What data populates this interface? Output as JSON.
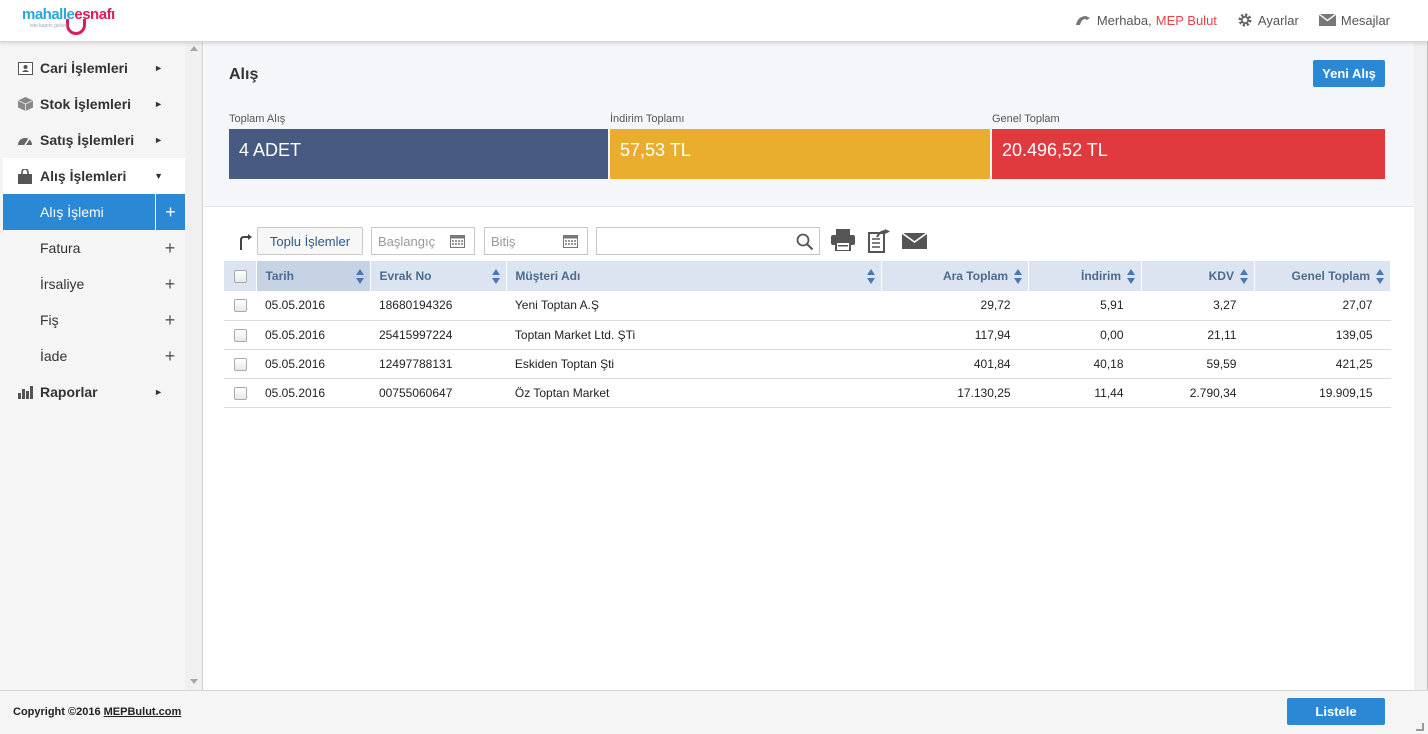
{
  "header": {
    "logo": {
      "word1": "mahalle",
      "word2": "esnafı",
      "tagline": "iste kapını gelsin"
    },
    "greeting": "Merhaba,",
    "user_name": "MEP Bulut",
    "settings_label": "Ayarlar",
    "messages_label": "Mesajlar"
  },
  "sidebar": {
    "items": [
      {
        "label": "Cari İşlemleri",
        "icon": "contact-card-icon"
      },
      {
        "label": "Stok İşlemleri",
        "icon": "box-icon"
      },
      {
        "label": "Satış İşlemleri",
        "icon": "speedometer-icon"
      },
      {
        "label": "Alış İşlemleri",
        "icon": "shopping-bag-icon"
      },
      {
        "label": "Raporlar",
        "icon": "bar-chart-icon"
      }
    ],
    "subitems": [
      {
        "label": "Alış İşlemi"
      },
      {
        "label": "Fatura"
      },
      {
        "label": "İrsaliye"
      },
      {
        "label": "Fiş"
      },
      {
        "label": "İade"
      }
    ]
  },
  "page": {
    "title": "Alış",
    "new_button": "Yeni Alış"
  },
  "summary": {
    "total": {
      "label": "Toplam Alış",
      "value": "4 ADET",
      "color": "#475a82"
    },
    "discount": {
      "label": "İndirim Toplamı",
      "value": "57,53 TL",
      "color": "#eaae2f"
    },
    "grand": {
      "label": "Genel Toplam",
      "value": "20.496,52 TL",
      "color": "#e03a3e"
    }
  },
  "toolbar": {
    "bulk_button": "Toplu İşlemler",
    "start_placeholder": "Başlangıç",
    "end_placeholder": "Bitiş",
    "search_value": ""
  },
  "table": {
    "columns": [
      "Tarih",
      "Evrak No",
      "Müşteri Adı",
      "Ara Toplam",
      "İndirim",
      "KDV",
      "Genel Toplam"
    ],
    "rows": [
      [
        "05.05.2016",
        "18680194326",
        "Yeni Toptan A.Ş",
        "29,72",
        "5,91",
        "3,27",
        "27,07"
      ],
      [
        "05.05.2016",
        "25415997224",
        "Toptan Market Ltd. ŞTi",
        "117,94",
        "0,00",
        "21,11",
        "139,05"
      ],
      [
        "05.05.2016",
        "12497788131",
        "Eskiden Toptan Şti",
        "401,84",
        "40,18",
        "59,59",
        "421,25"
      ],
      [
        "05.05.2016",
        "00755060647",
        "Öz Toptan Market",
        "17.130,25",
        "11,44",
        "2.790,34",
        "19.909,15"
      ]
    ]
  },
  "footer": {
    "copyright": "Copyright ©2016",
    "company_link": "MEPBulut.com",
    "list_button": "Listele"
  }
}
